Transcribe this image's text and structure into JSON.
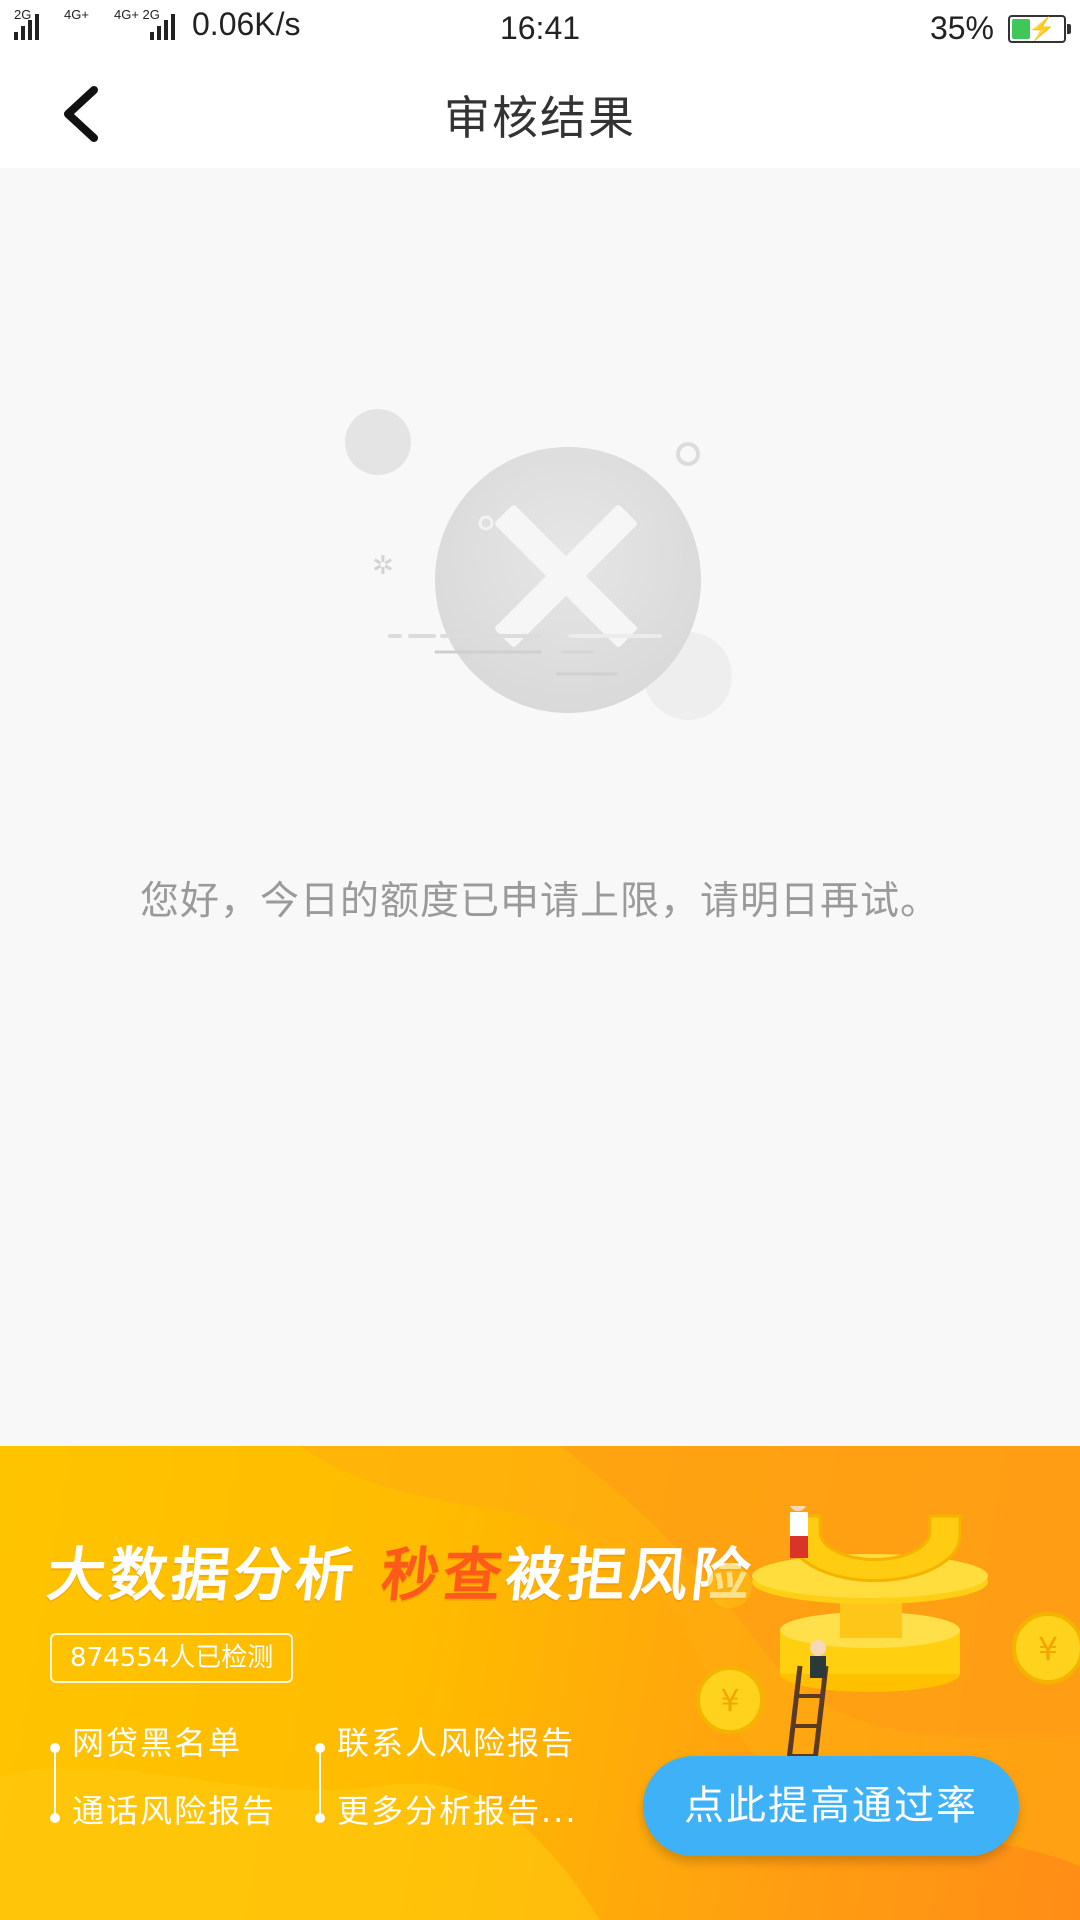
{
  "status_bar": {
    "signal1_label": "2G",
    "signal2_label": "4G+",
    "signal3_label": "4G+ 2G",
    "net_speed": "0.06K/s",
    "time": "16:41",
    "battery_percent": "35%",
    "battery_level": 0.35
  },
  "header": {
    "title": "审核结果"
  },
  "result": {
    "icon": "rejected-x-icon",
    "message": "您好，今日的额度已申请上限，请明日再试。"
  },
  "banner": {
    "headline_part1": "大数据分析 ",
    "headline_part2": "秒查",
    "headline_part3": "被拒风险",
    "count_text": "874554人已检测",
    "features_left": [
      "网贷黑名单",
      "通话风险报告"
    ],
    "features_right": [
      "联系人风险报告",
      "更多分析报告..."
    ],
    "cta_label": "点此提高通过率"
  },
  "colors": {
    "cta": "#3fb2f7",
    "banner_start": "#ffc400",
    "banner_end": "#ff8d16",
    "headline_highlight": "#ff5a1a",
    "message_text": "#9a9a9a"
  }
}
